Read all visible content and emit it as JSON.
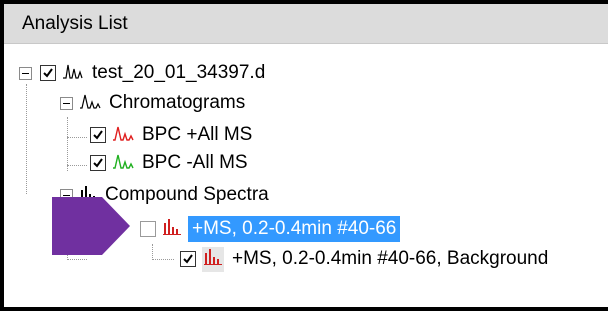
{
  "panel": {
    "title": "Analysis List"
  },
  "tree": {
    "file": {
      "label": "test_20_01_34397.d",
      "checked": true
    },
    "chromatograms": {
      "label": "Chromatograms",
      "items": [
        {
          "label": "BPC +All MS",
          "checked": true,
          "icon_color": "#e02020"
        },
        {
          "label": "BPC -All MS",
          "checked": true,
          "icon_color": "#20b020"
        }
      ]
    },
    "compound_spectra": {
      "label": "Compound Spectra",
      "items": [
        {
          "label": "+MS, 0.2-0.4min #40-66",
          "checked": false,
          "selected": true
        },
        {
          "label": "+MS, 0.2-0.4min #40-66, Background",
          "checked": true,
          "selected": false
        }
      ]
    }
  },
  "colors": {
    "selection": "#3399ff",
    "annotation_arrow": "#7030a0",
    "spectrum_icon": "#d02020",
    "header_bg": "#dcdcdc"
  },
  "icons": {
    "file": "peaks-icon",
    "chromatogram": "chromatogram-icon",
    "spectrum": "spectrum-icon",
    "annotation": "arrow-pointer"
  }
}
